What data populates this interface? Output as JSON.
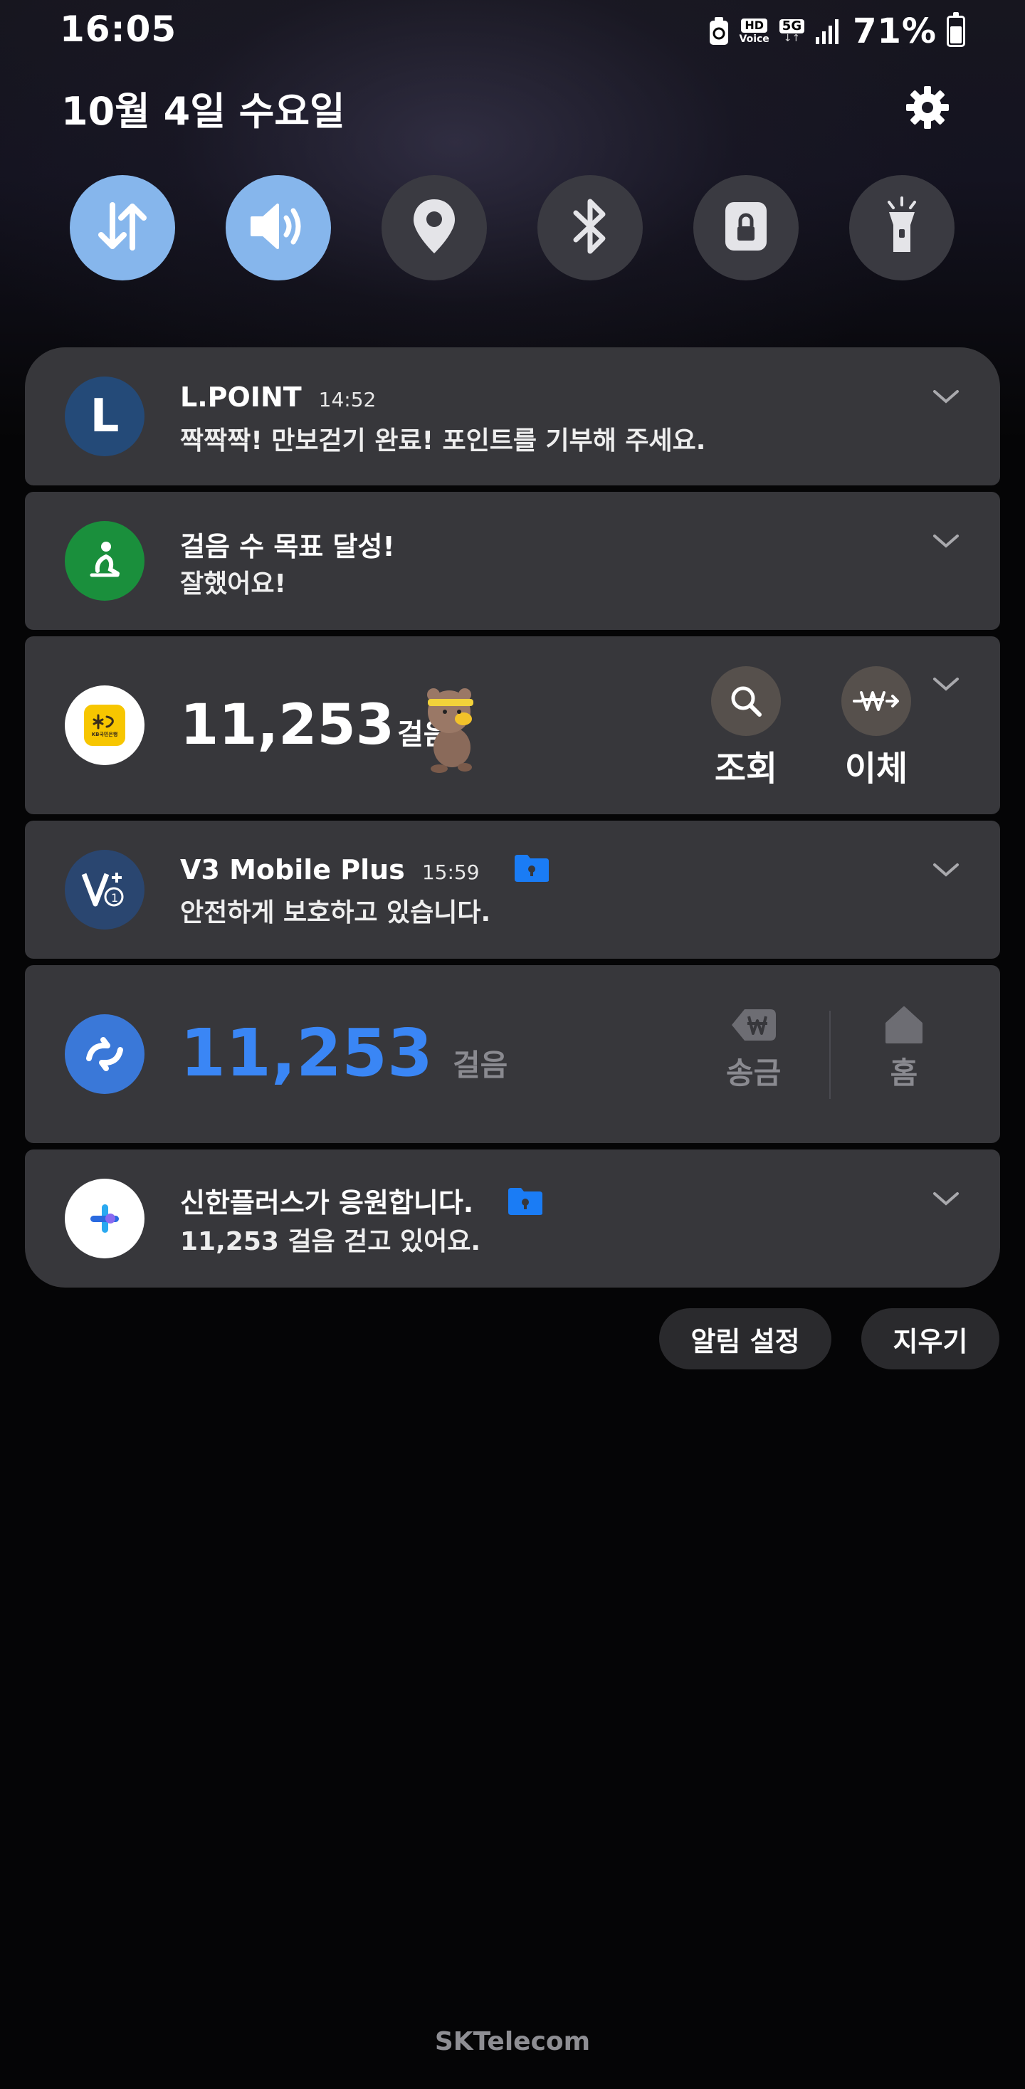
{
  "status_bar": {
    "time": "16:05",
    "hd_label": "HD",
    "voice_label": "Voice",
    "network_label": "5G",
    "battery_percent": "71%",
    "battery_level": 0.71,
    "icons": [
      "recycle-icon",
      "hd-voice-icon",
      "5g-icon",
      "signal-icon",
      "battery-icon"
    ]
  },
  "header": {
    "date": "10월 4일 수요일",
    "settings_icon": "gear-icon"
  },
  "quick_toggles": [
    {
      "name": "mobile-data",
      "icon": "data-arrows-icon",
      "active": true
    },
    {
      "name": "sound",
      "icon": "speaker-icon",
      "active": true
    },
    {
      "name": "location",
      "icon": "location-pin-icon",
      "active": false
    },
    {
      "name": "bluetooth",
      "icon": "bluetooth-icon",
      "active": false
    },
    {
      "name": "screen-lock",
      "icon": "lock-icon",
      "active": false
    },
    {
      "name": "flashlight",
      "icon": "flashlight-icon",
      "active": false
    }
  ],
  "notifications": {
    "lpoint": {
      "app_letter": "L",
      "title": "L.POINT",
      "time": "14:52",
      "body": "짝짝짝! 만보걷기 완료! 포인트를 기부해 주세요."
    },
    "steps_goal": {
      "title": "걸음 수 목표 달성!",
      "body": "잘했어요!"
    },
    "kb": {
      "icon_label": "KB국민은행",
      "steps": "11,253",
      "unit": "걸음",
      "actions": [
        {
          "label": "조회",
          "icon": "search-icon"
        },
        {
          "label": "이체",
          "icon": "won-transfer-icon"
        }
      ]
    },
    "v3": {
      "title": "V3 Mobile Plus",
      "time": "15:59",
      "body": "안전하게 보호하고 있습니다."
    },
    "toss": {
      "steps": "11,253",
      "unit": "걸음",
      "actions": [
        {
          "label": "송금",
          "icon": "won-send-icon"
        },
        {
          "label": "홈",
          "icon": "home-icon"
        }
      ]
    },
    "shinhan": {
      "title": "신한플러스가 응원합니다.",
      "body": "11,253 걸음 걷고 있어요."
    }
  },
  "footer_buttons": {
    "notification_settings": "알림 설정",
    "clear": "지우기"
  },
  "carrier": "SKTelecom",
  "colors": {
    "toggle_on": "#86b6ec",
    "toggle_off": "#3a3a41",
    "card_bg": "#37373b",
    "accent_blue": "#3a86f5",
    "folder_blue": "#1a7cf5"
  }
}
